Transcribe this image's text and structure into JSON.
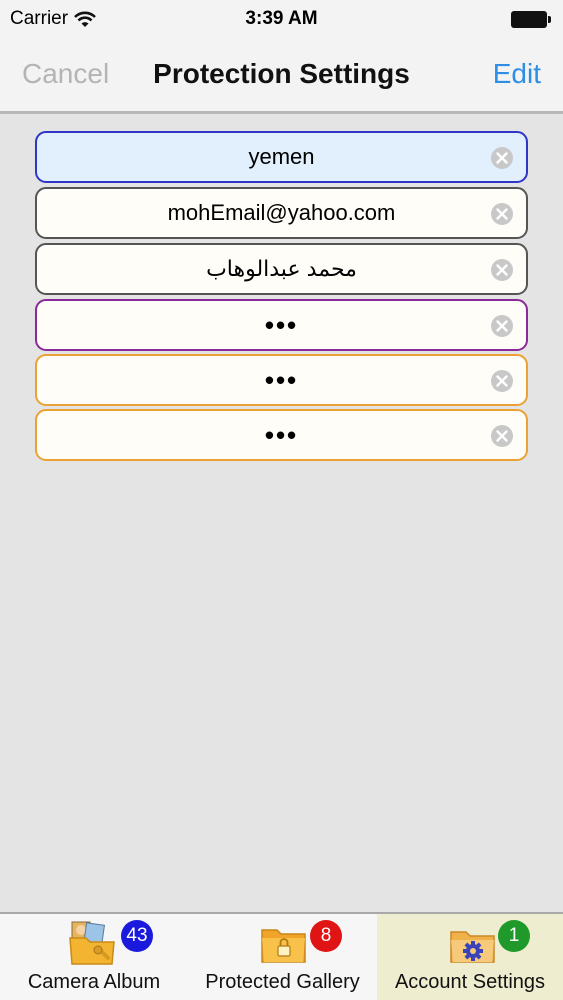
{
  "status_bar": {
    "carrier": "Carrier",
    "time": "3:39 AM",
    "wifi_icon": "wifi-icon",
    "battery_icon": "battery-icon"
  },
  "nav": {
    "cancel_label": "Cancel",
    "title": "Protection Settings",
    "edit_label": "Edit",
    "cancel_color": "#b4b4b4",
    "edit_color": "#2e8ee6"
  },
  "form": {
    "fields": [
      {
        "value": "yemen",
        "border_color": "#2e35c8",
        "bg_color": "#e2effd"
      },
      {
        "value": "mohEmail@yahoo.com",
        "border_color": "#555555"
      },
      {
        "value": "محمد عبدالوهاب",
        "border_color": "#555555"
      },
      {
        "value": "•••",
        "border_color": "#8a2a9a"
      },
      {
        "value": "•••",
        "border_color": "#eba234"
      },
      {
        "value": "•••",
        "border_color": "#eba234"
      }
    ],
    "clear_icon": "clear-circle-icon"
  },
  "tabs": [
    {
      "label": "Camera Album",
      "badge": "43",
      "badge_color": "#1a1adc",
      "icon": "camera-album-folder-icon"
    },
    {
      "label": "Protected Gallery",
      "badge": "8",
      "badge_color": "#e01414",
      "icon": "locked-folder-icon"
    },
    {
      "label": "Account Settings",
      "badge": "1",
      "badge_color": "#1f9a2a",
      "icon": "settings-folder-icon",
      "selected": true
    }
  ]
}
